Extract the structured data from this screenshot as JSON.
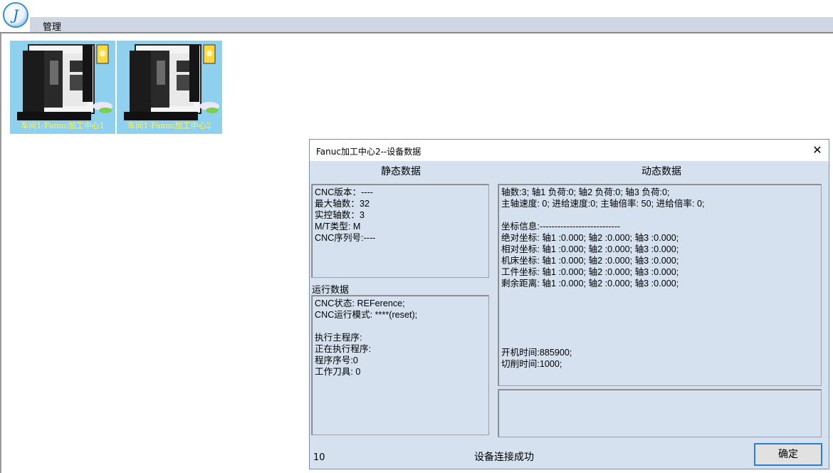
{
  "app": {
    "logo_glyph": "J",
    "menu": [
      "管理"
    ]
  },
  "machines": [
    {
      "label": "车间1-Fanuc加工中心1"
    },
    {
      "label": "车间1-Fanuc加工中心2"
    }
  ],
  "dialog": {
    "title": "Fanuc加工中心2--设备数据",
    "close_glyph": "✕",
    "static_header": "静态数据",
    "dynamic_header": "动态数据",
    "run_header": "运行数据",
    "static_lines": [
      "CNC版本：----",
      "最大轴数：32",
      "实控轴数：3",
      "M/T类型: M",
      "CNC序列号:----"
    ],
    "run_lines": [
      "CNC状态: REFerence;",
      "CNC运行模式: ****(reset);",
      "",
      "执行主程序:",
      "正在执行程序:",
      "程序序号:0",
      "工作刀具: 0"
    ],
    "dynamic_lines_top": [
      "轴数:3; 轴1 负荷:0; 轴2 负荷:0; 轴3 负荷:0;",
      "主轴速度: 0; 进给速度:0; 主轴倍率: 50; 进给倍率: 0;",
      "",
      "坐标信息:---------------------------",
      "绝对坐标: 轴1 :0.000; 轴2 :0.000; 轴3 :0.000;",
      "相对坐标: 轴1 :0.000; 轴2 :0.000; 轴3 :0.000;",
      "机床坐标: 轴1 :0.000; 轴2 :0.000; 轴3 :0.000;",
      "工件坐标: 轴1 :0.000; 轴2 :0.000; 轴3 :0.000;",
      "剩余距离: 轴1 :0.000; 轴2 :0.000; 轴3 :0.000;"
    ],
    "dynamic_lines_bottom": [
      "开机时间:885900;",
      "切削时间:1000;"
    ],
    "footer_count": "10",
    "footer_status": "设备连接成功",
    "ok_label": "确定"
  }
}
